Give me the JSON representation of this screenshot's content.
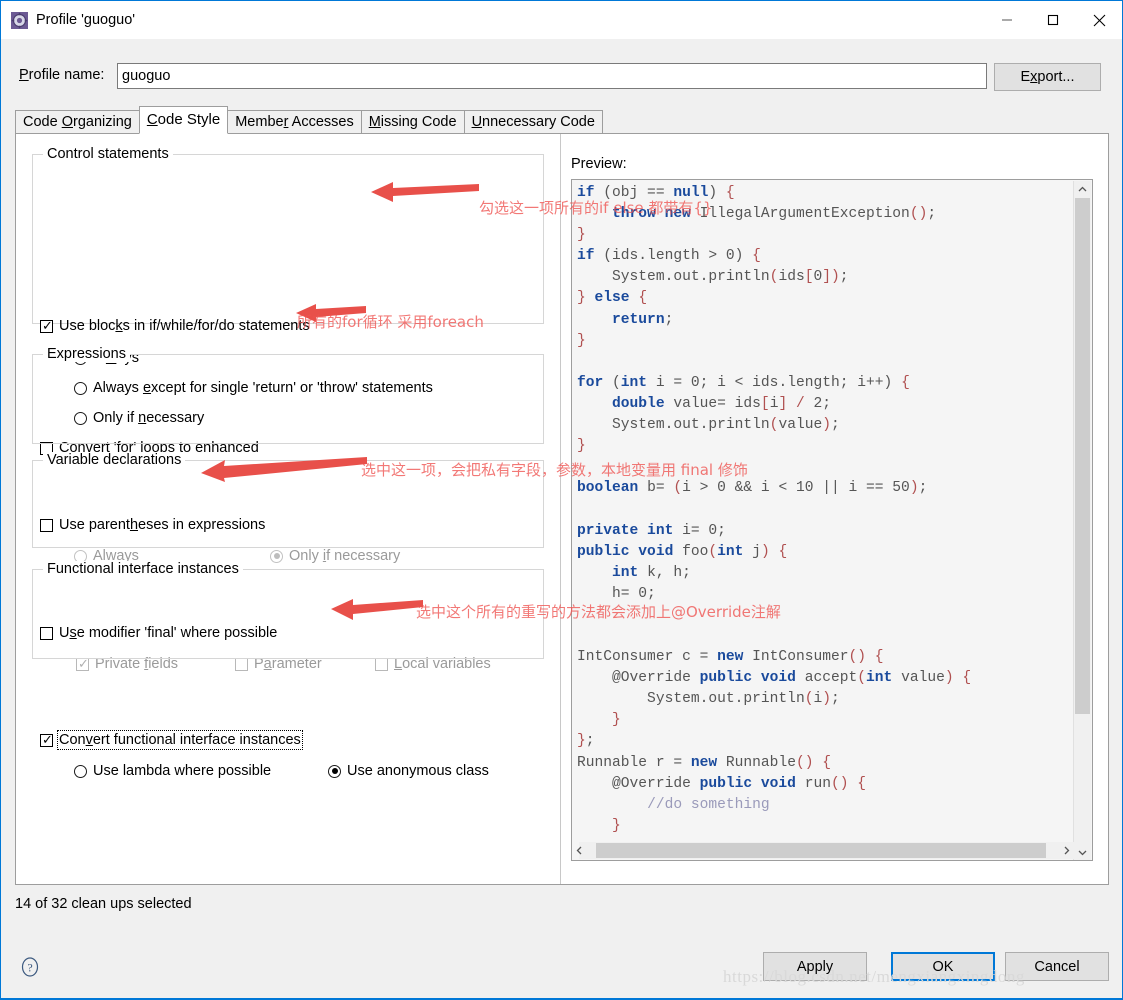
{
  "window": {
    "title": "Profile 'guoguo'",
    "icon": "profile-gear-icon",
    "minimize": "–",
    "maximize": "□",
    "close": "✕"
  },
  "profile": {
    "label_pre": "P",
    "label_rest": "rofile name:",
    "value": "guoguo",
    "export_label_pre": "E",
    "export_label_mid": "x",
    "export_label_rest": "port..."
  },
  "tabs": [
    {
      "label": "Code Organizing",
      "active": false
    },
    {
      "label": "Code Style",
      "active": true
    },
    {
      "label": "Member Accesses",
      "active": false
    },
    {
      "label": "Missing Code",
      "active": false
    },
    {
      "label": "Unnecessary Code",
      "active": false
    }
  ],
  "groups": {
    "control": {
      "title": "Control statements",
      "use_blocks": "Use blocks in if/while/for/do statements",
      "use_blocks_checked": true,
      "radios": [
        {
          "label": "Always",
          "selected": true
        },
        {
          "label": "Always except for single 'return' or 'throw' statements",
          "selected": false
        },
        {
          "label": "Only if necessary",
          "selected": false
        }
      ],
      "convert_for": "Convert 'for' loops to enhanced",
      "convert_for_checked": false
    },
    "expressions": {
      "title": "Expressions",
      "use_parens": "Use parentheses in expressions",
      "use_parens_checked": false,
      "radios": [
        {
          "label": "Always",
          "selected": false,
          "disabled": true
        },
        {
          "label": "Only if necessary",
          "selected": true,
          "disabled": true
        }
      ]
    },
    "variables": {
      "title": "Variable declarations",
      "use_final": "Use modifier 'final' where possible",
      "use_final_checked": false,
      "sub": [
        {
          "label": "Private fields",
          "checked": true,
          "disabled": true
        },
        {
          "label": "Parameter",
          "checked": false,
          "disabled": true
        },
        {
          "label": "Local variables",
          "checked": false,
          "disabled": true
        }
      ]
    },
    "functional": {
      "title": "Functional interface instances",
      "convert_fi": "Convert functional interface instances",
      "convert_fi_checked": true,
      "radios": [
        {
          "label": "Use lambda where possible",
          "selected": false
        },
        {
          "label": "Use anonymous class",
          "selected": true
        }
      ]
    }
  },
  "preview": {
    "label": "Preview:",
    "code_lines": [
      "if (obj == null) {",
      "    throw new IllegalArgumentException();",
      "}",
      "if (ids.length > 0) {",
      "    System.out.println(ids[0]);",
      "} else {",
      "    return;",
      "}",
      "",
      "for (int i = 0; i < ids.length; i++) {",
      "    double value= ids[i] / 2;",
      "    System.out.println(value);",
      "}",
      "",
      "boolean b= (i > 0 && i < 10 || i == 50);",
      "",
      "private int i= 0;",
      "public void foo(int j) {",
      "    int k, h;",
      "    h= 0;",
      "",
      "",
      "IntConsumer c = new IntConsumer() {",
      "    @Override public void accept(int value) {",
      "        System.out.println(i);",
      "    }",
      "};",
      "Runnable r = new Runnable() {",
      "    @Override public void run() {",
      "        //do something",
      "    }"
    ],
    "scroll_up": "⌃",
    "scroll_down": "⌄",
    "scroll_left": "‹",
    "scroll_right": "›"
  },
  "annotations": [
    {
      "text": "勾选这一项所有的if else 都带有{}"
    },
    {
      "text": "所有的for循环 采用foreach"
    },
    {
      "text": "选中这一项，会把私有字段，参数，本地变量用 final 修饰"
    },
    {
      "text": "选中这个所有的重写的方法都会添加上@Override注解"
    }
  ],
  "status": "14 of 32 clean ups selected",
  "buttons": {
    "apply": "Apply",
    "ok": "OK",
    "cancel": "Cancel",
    "help": "?"
  },
  "watermark": "https://blog.csdn.net/mengxiangxingdong",
  "colors": {
    "accent": "#0078d7",
    "annotation": "#ef5350",
    "keyword": "#1a4a9c",
    "bracket": "#b05050",
    "comment": "#9a9aba",
    "code_plain": "#555555"
  }
}
